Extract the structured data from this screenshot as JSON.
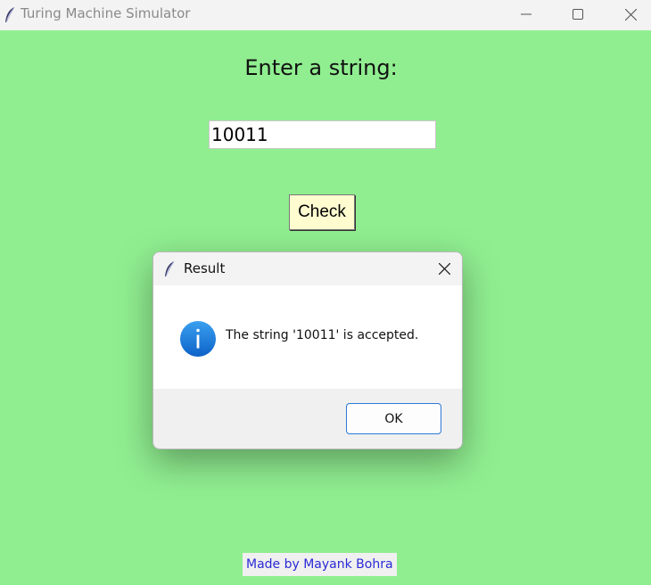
{
  "window": {
    "title": "Turing Machine Simulator",
    "icon": "feather-icon"
  },
  "main": {
    "prompt": "Enter a string:",
    "input_value": "10011",
    "check_label": "Check",
    "footer": "Made by Mayank Bohra"
  },
  "dialog": {
    "title": "Result",
    "icon": "info-icon",
    "message": "The string '10011' is accepted.",
    "ok_label": "OK"
  },
  "colors": {
    "background": "#90ee90",
    "button": "#fffdd0",
    "footer_text": "#2a2ad6",
    "info_blue": "#1a78d8"
  }
}
